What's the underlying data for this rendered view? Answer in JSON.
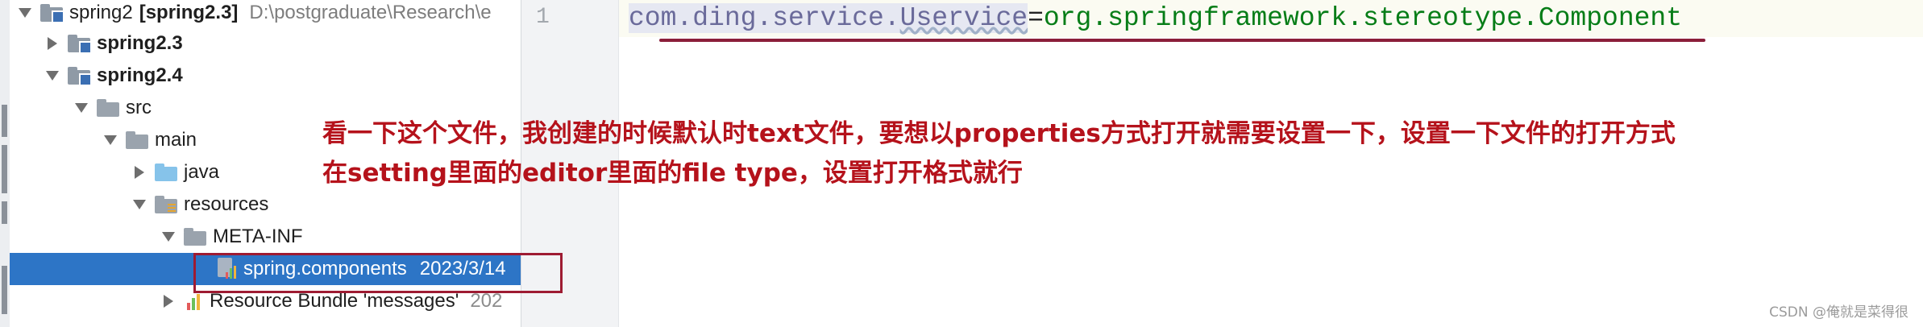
{
  "project_tree": {
    "root": {
      "name": "spring2",
      "module": "[spring2.3]",
      "path": "D:\\postgraduate\\Research\\e"
    },
    "items": [
      {
        "label": "spring2.3"
      },
      {
        "label": "spring2.4"
      },
      {
        "label": "src"
      },
      {
        "label": "main"
      },
      {
        "label": "java"
      },
      {
        "label": "resources"
      },
      {
        "label": "META-INF"
      },
      {
        "label": "spring.components",
        "date": "2023/3/14"
      },
      {
        "label": "Resource Bundle 'messages'",
        "suffix": "202"
      }
    ]
  },
  "editor": {
    "line_number": "1",
    "code": {
      "key_prefix": "com.ding.service.",
      "key_word": "Uservice",
      "equals": "=",
      "value": "org.springframework.stereotype.Component"
    }
  },
  "annotation": {
    "line1": "看一下这个文件，我创建的时候默认时text文件，要想以properties方式打开就需要设置一下，设置一下文件的打开方式",
    "line2": "在setting里面的editor里面的file type，设置打开格式就行"
  },
  "watermark": "CSDN @俺就是菜得很",
  "colors": {
    "selection": "#2d75c6",
    "annotation_red": "#b5121b",
    "box_red": "#9e1b32",
    "code_value_green": "#067d17"
  },
  "icons": {
    "folder": "folder-icon",
    "module_folder": "module-folder-icon",
    "source_folder": "source-folder-icon",
    "resources_folder": "resources-folder-icon",
    "properties_file": "properties-file-icon",
    "bundle": "resource-bundle-icon"
  }
}
